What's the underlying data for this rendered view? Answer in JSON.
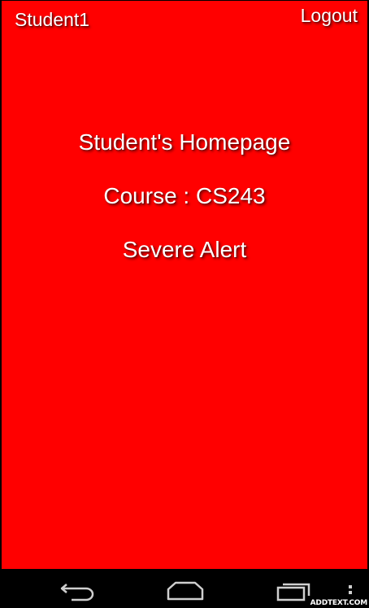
{
  "header": {
    "user_label": "Student1",
    "logout_label": "Logout"
  },
  "main": {
    "title": "Student's Homepage",
    "course": "Course : CS243",
    "alert": "Severe Alert"
  },
  "navbar": {
    "buttons": [
      "back-icon",
      "home-icon",
      "recent-apps-icon",
      "overflow-menu-icon"
    ]
  },
  "watermark": "ADDTEXT.COM",
  "colors": {
    "background": "#ff0000",
    "text": "#ffffff",
    "navbar": "#000000"
  }
}
